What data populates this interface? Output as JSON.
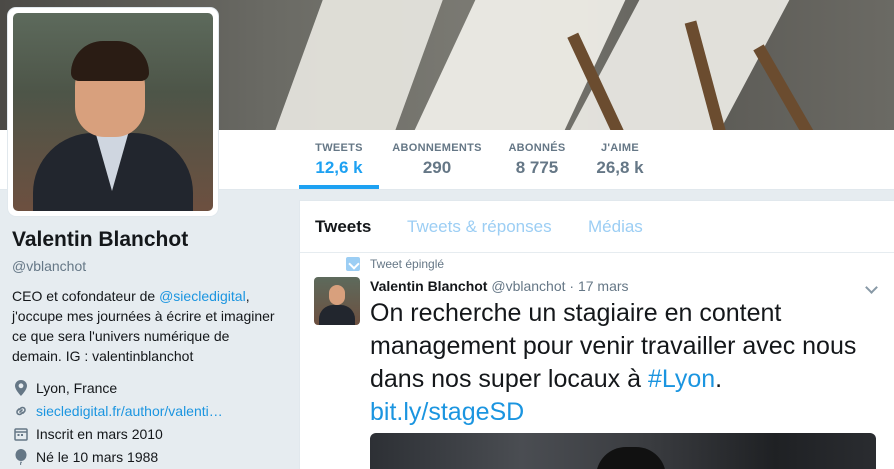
{
  "profile": {
    "name": "Valentin Blanchot",
    "handle": "@vblanchot",
    "bio_prefix": "CEO et cofondateur de ",
    "bio_mention": "@siecledigital",
    "bio_suffix": ", j'occupe mes journées à écrire et imaginer ce que sera l'univers numérique de demain. IG : valentinblanchot",
    "location": "Lyon, France",
    "website": "siecledigital.fr/author/valenti…",
    "joined": "Inscrit en mars 2010",
    "birthday": "Né le 10 mars 1988"
  },
  "stats": [
    {
      "label": "TWEETS",
      "value": "12,6 k"
    },
    {
      "label": "ABONNEMENTS",
      "value": "290"
    },
    {
      "label": "ABONNÉS",
      "value": "8 775"
    },
    {
      "label": "J'AIME",
      "value": "26,8 k"
    }
  ],
  "tabs": [
    "Tweets",
    "Tweets & réponses",
    "Médias"
  ],
  "tweet": {
    "pinned_label": "Tweet épinglé",
    "author": "Valentin Blanchot",
    "handle": "@vblanchot",
    "date": "· 17 mars",
    "text": "On recherche un stagiaire en content management pour venir travailler avec nous dans nos super locaux à ",
    "hashtag": "#Lyon",
    "text_end": ".",
    "link": "bit.ly/stageSD"
  },
  "icons": [
    "location-icon",
    "link-icon",
    "calendar-icon",
    "balloon-icon",
    "pin-icon",
    "caret-down-icon"
  ],
  "colors": {
    "accent": "#1da1f2",
    "link": "#1b95e0",
    "muted": "#657786",
    "tab_inactive": "#9ccef4"
  }
}
